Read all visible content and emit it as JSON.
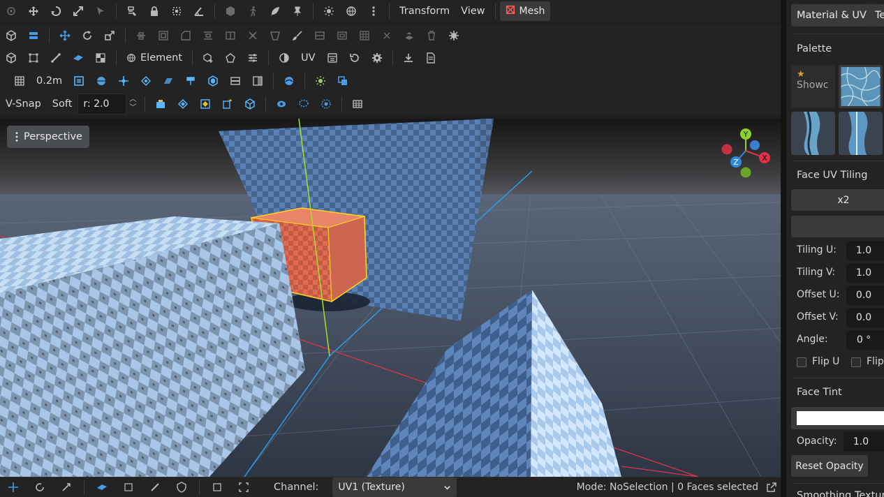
{
  "toolbar": {
    "transform_menu": "Transform",
    "view_menu": "View",
    "mesh_label": "Mesh",
    "element_label": "Element",
    "uv_label": "UV",
    "grid_size": "0.2m",
    "vsnap_label": "V-Snap",
    "soft_label": "Soft",
    "radius_value": "r: 2.0"
  },
  "viewport": {
    "perspective_label": "Perspective",
    "gizmo": {
      "y": "Y",
      "x": "X",
      "z": "Z"
    }
  },
  "bottom_bar": {
    "channel_label": "Channel:",
    "channel_value": "UV1 (Texture)",
    "mode_text": "Mode: NoSelection | 0 Faces selected"
  },
  "panel": {
    "tab_material": "Material & UV",
    "tab_second": "Te",
    "palette_heading": "Palette",
    "showcase_label": "Showc",
    "face_uv_tiling_heading": "Face UV Tiling",
    "x2_button": "x2",
    "tiling_u_label": "Tiling U:",
    "tiling_u_value": "1.0",
    "tiling_v_label": "Tiling V:",
    "tiling_v_value": "1.0",
    "offset_u_label": "Offset U:",
    "offset_u_value": "0.0",
    "offset_v_label": "Offset V:",
    "offset_v_value": "0.0",
    "angle_label": "Angle:",
    "angle_value": "0 °",
    "flip_u_label": "Flip U",
    "flip_v_label": "Flip",
    "face_tint_heading": "Face Tint",
    "opacity_label": "Opacity:",
    "opacity_value": "1.0",
    "reset_opacity_button": "Reset Opacity",
    "cut_heading": "Smoothing Texture"
  },
  "colors": {
    "accent_blue": "#4a9be8",
    "selection_yellow": "#ffd21f",
    "selected_cube": "#d8664e",
    "axis_x": "#e0334a",
    "axis_y": "#8ed12f",
    "axis_z": "#2f8be0"
  }
}
